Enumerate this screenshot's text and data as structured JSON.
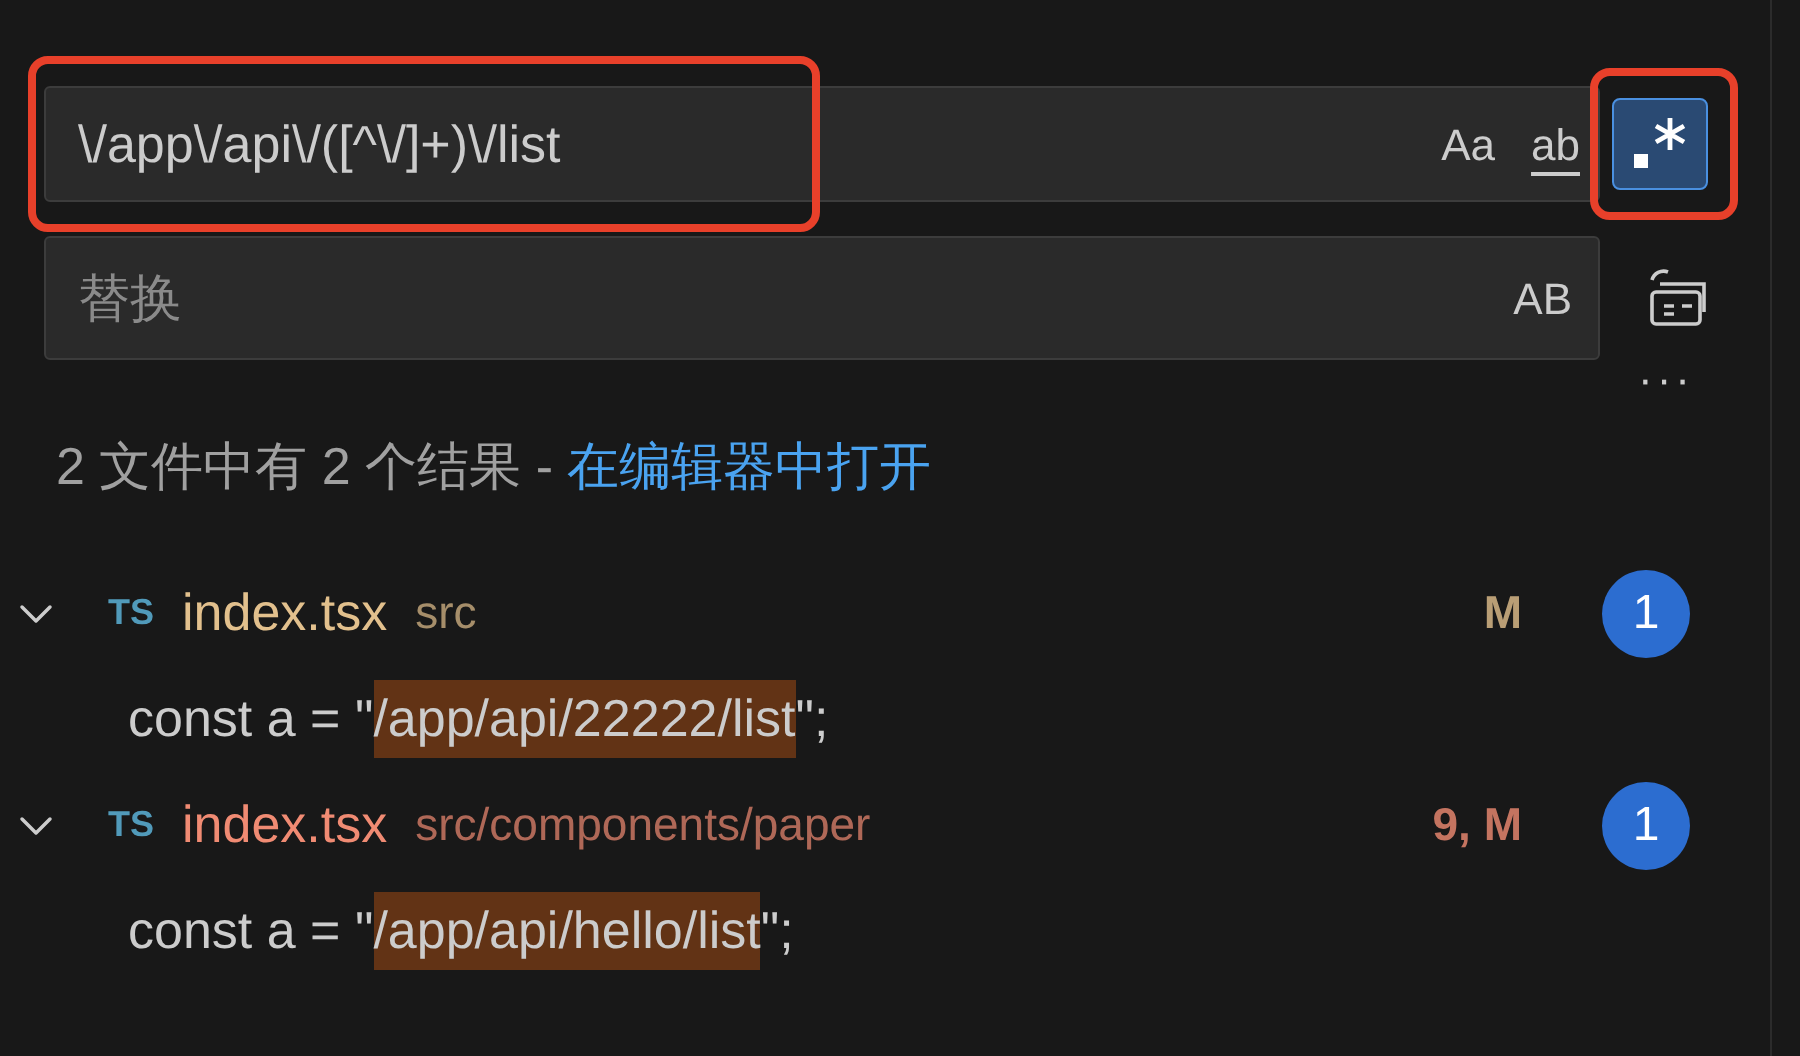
{
  "search": {
    "value": "\\/app\\/api\\/([^\\/]+)\\/list",
    "toggles": [
      {
        "kind": "case",
        "label": "Aa",
        "on": false
      },
      {
        "kind": "word",
        "label": "ab",
        "on": false
      },
      {
        "kind": "regex",
        "on": true
      }
    ]
  },
  "replace": {
    "placeholder": "替换",
    "toggles": [
      {
        "kind": "preserve",
        "label": "AB",
        "on": false
      }
    ]
  },
  "more": "···",
  "summary": {
    "text": "2 文件中有 2 个结果 - ",
    "link": "在编辑器中打开"
  },
  "files": [
    {
      "expanded": true,
      "lang": "TS",
      "name": "index.tsx",
      "path": "src",
      "status": "M",
      "count": "1",
      "color": "#e2c08d",
      "matches": [
        {
          "before": "const a = \"",
          "match": "/app/api/22222/list",
          "after": "\";"
        }
      ]
    },
    {
      "expanded": true,
      "lang": "TS",
      "name": "index.tsx",
      "path": "src/components/paper",
      "status": "9, M",
      "count": "1",
      "color": "#f08b73",
      "matches": [
        {
          "before": "const a = \"",
          "match": "/app/api/hello/list",
          "after": "\";"
        }
      ]
    }
  ]
}
